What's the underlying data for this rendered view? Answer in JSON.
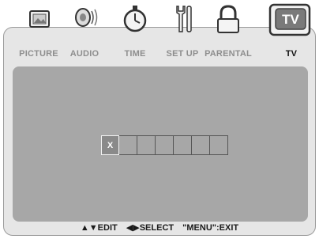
{
  "tabs": [
    {
      "label": "PICTURE",
      "icon": "picture-icon",
      "active": false
    },
    {
      "label": "AUDIO",
      "icon": "speaker-icon",
      "active": false
    },
    {
      "label": "TIME",
      "icon": "stopwatch-icon",
      "active": false
    },
    {
      "label": "SET UP",
      "icon": "tools-icon",
      "active": false
    },
    {
      "label": "PARENTAL",
      "icon": "padlock-icon",
      "active": false
    },
    {
      "label": "TV",
      "icon": "tv-icon",
      "active": true
    }
  ],
  "tv_icon_text": "TV",
  "code_entry": {
    "current_char": "X",
    "total_boxes": 7
  },
  "footer": {
    "edit_hint": "▲▼EDIT",
    "select_hint": "◀▶SELECT",
    "exit_hint": "\"MENU\":EXIT"
  },
  "colors": {
    "panel": "#a7a7a7",
    "frame": "#e6e6e6",
    "inactive_label": "#8e8e8e",
    "active_label": "#111111"
  }
}
